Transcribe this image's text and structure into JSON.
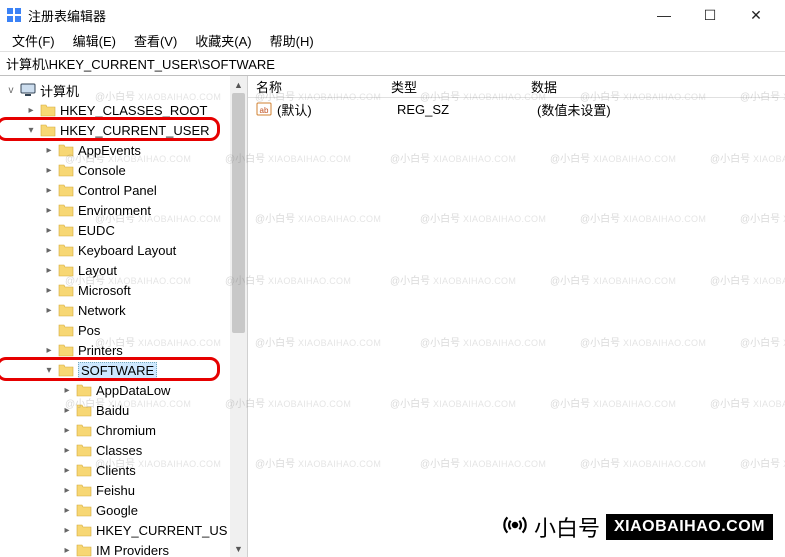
{
  "window": {
    "title": "注册表编辑器"
  },
  "menu": {
    "file": "文件(F)",
    "edit": "编辑(E)",
    "view": "查看(V)",
    "favorites": "收藏夹(A)",
    "help": "帮助(H)"
  },
  "addressbar": {
    "path": "计算机\\HKEY_CURRENT_USER\\SOFTWARE"
  },
  "tree": {
    "root": "计算机",
    "items": [
      {
        "depth": 1,
        "expander": ">",
        "label": "HKEY_CLASSES_ROOT"
      },
      {
        "depth": 1,
        "expander": "v",
        "label": "HKEY_CURRENT_USER",
        "highlight": true
      },
      {
        "depth": 2,
        "expander": ">",
        "label": "AppEvents"
      },
      {
        "depth": 2,
        "expander": ">",
        "label": "Console"
      },
      {
        "depth": 2,
        "expander": ">",
        "label": "Control Panel"
      },
      {
        "depth": 2,
        "expander": ">",
        "label": "Environment"
      },
      {
        "depth": 2,
        "expander": ">",
        "label": "EUDC"
      },
      {
        "depth": 2,
        "expander": ">",
        "label": "Keyboard Layout"
      },
      {
        "depth": 2,
        "expander": ">",
        "label": "Layout"
      },
      {
        "depth": 2,
        "expander": ">",
        "label": "Microsoft"
      },
      {
        "depth": 2,
        "expander": ">",
        "label": "Network"
      },
      {
        "depth": 2,
        "expander": "",
        "label": "Pos"
      },
      {
        "depth": 2,
        "expander": ">",
        "label": "Printers"
      },
      {
        "depth": 2,
        "expander": "v",
        "label": "SOFTWARE",
        "highlight": true,
        "selected": true
      },
      {
        "depth": 3,
        "expander": ">",
        "label": "AppDataLow"
      },
      {
        "depth": 3,
        "expander": ">",
        "label": "Baidu"
      },
      {
        "depth": 3,
        "expander": ">",
        "label": "Chromium"
      },
      {
        "depth": 3,
        "expander": ">",
        "label": "Classes"
      },
      {
        "depth": 3,
        "expander": ">",
        "label": "Clients"
      },
      {
        "depth": 3,
        "expander": ">",
        "label": "Feishu"
      },
      {
        "depth": 3,
        "expander": ">",
        "label": "Google"
      },
      {
        "depth": 3,
        "expander": ">",
        "label": "HKEY_CURRENT_US"
      },
      {
        "depth": 3,
        "expander": ">",
        "label": "IM Providers"
      }
    ]
  },
  "list": {
    "headers": {
      "name": "名称",
      "type": "类型",
      "data": "数据"
    },
    "rows": [
      {
        "name": "(默认)",
        "type": "REG_SZ",
        "data": "(数值未设置)"
      }
    ]
  },
  "watermark": {
    "cn": "@小白号",
    "en": "XIAOBAIHAO.COM"
  },
  "brand": {
    "cn": "小白号",
    "en": "XIAOBAIHAO.COM"
  }
}
